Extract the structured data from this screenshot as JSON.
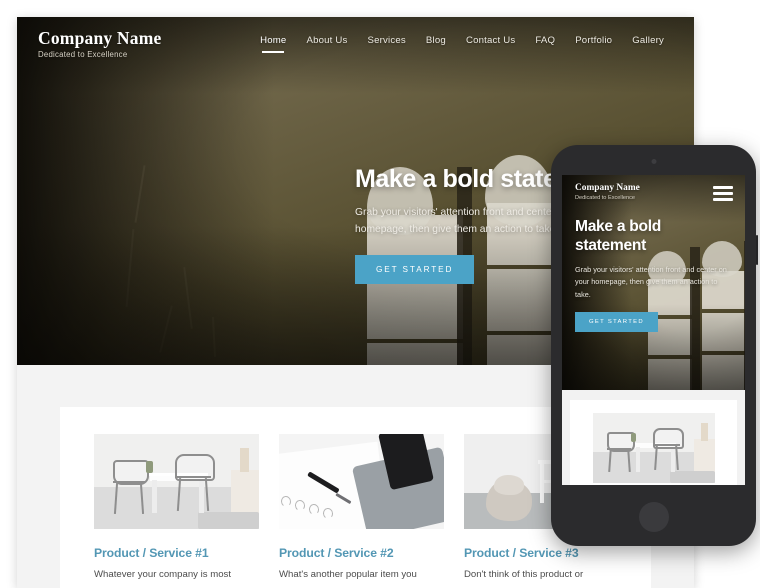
{
  "desktop": {
    "brand": {
      "name": "Company Name",
      "tagline": "Dedicated to Excellence"
    },
    "nav": [
      {
        "label": "Home",
        "active": true
      },
      {
        "label": "About Us",
        "active": false
      },
      {
        "label": "Services",
        "active": false
      },
      {
        "label": "Blog",
        "active": false
      },
      {
        "label": "Contact Us",
        "active": false
      },
      {
        "label": "FAQ",
        "active": false
      },
      {
        "label": "Portfolio",
        "active": false
      },
      {
        "label": "Gallery",
        "active": false
      }
    ],
    "hero": {
      "heading": "Make a bold statement",
      "subheading": "Grab your visitors' attention front and center on your homepage, then give them an action to take.",
      "cta_label": "GET STARTED"
    },
    "columns": [
      {
        "title": "Product / Service #1",
        "text": "Whatever your company is most",
        "image_name": "dining-table-metal-chairs-photo"
      },
      {
        "title": "Product / Service #2",
        "text": "What's another popular item you",
        "image_name": "desk-pen-tablet-phone-photo"
      },
      {
        "title": "Product / Service #3",
        "text": "Don't think of this product or",
        "image_name": "fur-throw-console-table-photo"
      }
    ]
  },
  "phone": {
    "brand": {
      "name": "Company Name",
      "tagline": "Dedicated to Excellence"
    },
    "menu_icon": "hamburger-menu-icon",
    "hero": {
      "heading": "Make a bold statement",
      "subheading": "Grab your visitors' attention front and center on your homepage, then give them an action to take.",
      "cta_label": "GET STARTED"
    },
    "content_image_name": "dining-table-metal-chairs-photo"
  },
  "colors": {
    "accent": "#4ba3c7",
    "heading_link": "#5397b4",
    "hero_overlay": "#57502f",
    "page_background": "#f3f3f3",
    "card_background": "#ffffff",
    "phone_frame": "#2b2b2d"
  }
}
